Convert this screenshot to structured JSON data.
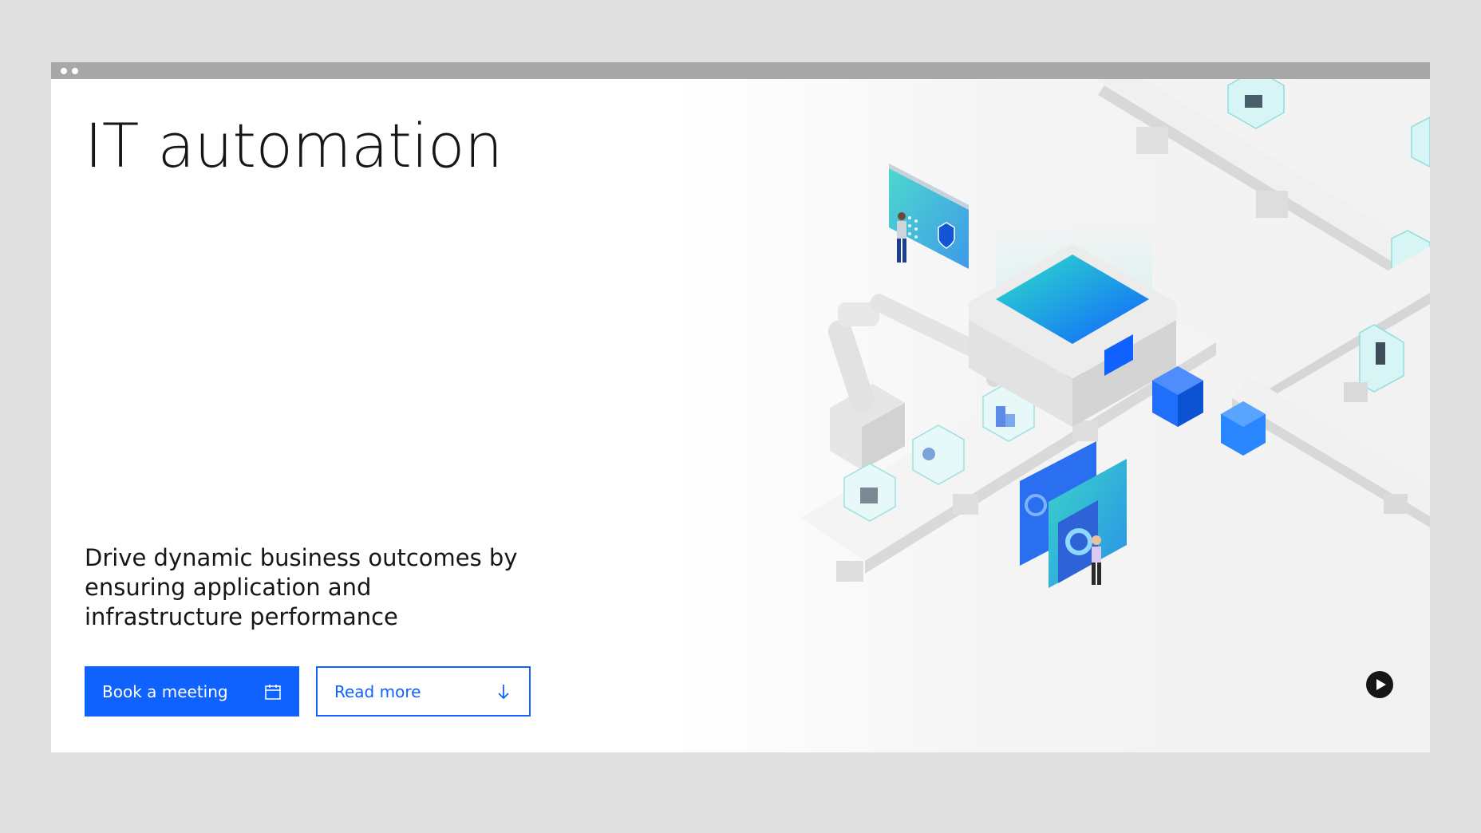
{
  "hero": {
    "title": "IT automation",
    "subtitle": "Drive dynamic business outcomes by ensuring application and infrastructure performance"
  },
  "actions": {
    "book_meeting_label": "Book a meeting",
    "book_meeting_icon": "calendar-icon",
    "read_more_label": "Read more",
    "read_more_icon": "arrow-down-icon"
  },
  "media": {
    "play_icon": "play-icon"
  },
  "colors": {
    "accent": "#0f62fe",
    "teal": "#2fd4c4",
    "text": "#161616"
  }
}
